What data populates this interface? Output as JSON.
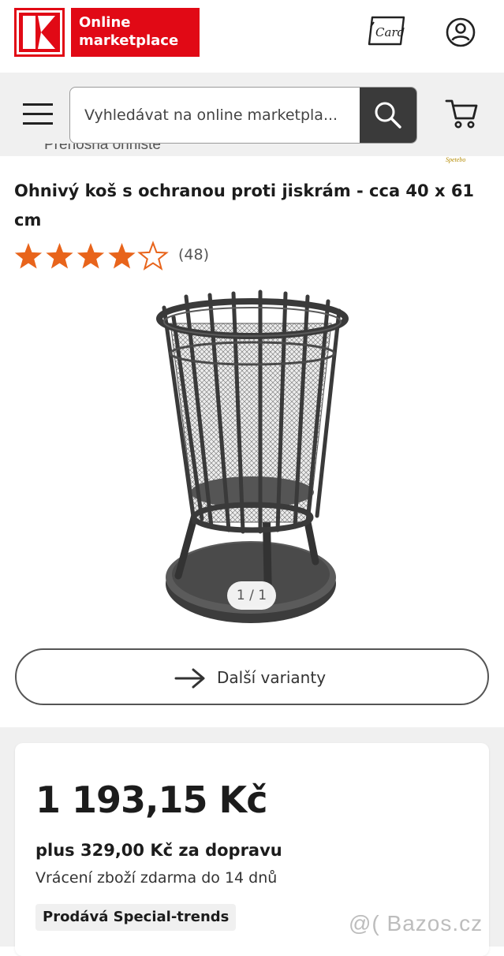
{
  "header": {
    "logo_text": "Online marketplace",
    "logo_brand_color": "#e10915",
    "card_icon": "kaufland-card-icon",
    "account_icon": "account-icon"
  },
  "search": {
    "menu_icon": "hamburger-menu-icon",
    "placeholder": "Vyhledávat na online marketpla...",
    "button_icon": "search-icon",
    "cart_icon": "cart-icon"
  },
  "breadcrumb": {
    "text": "Přenosná ohniště"
  },
  "brand_mark": "Spetebo",
  "product": {
    "title": "Ohnivý koš s ochranou proti jiskrám - cca 40 x 61 cm",
    "rating": 4,
    "rating_max": 5,
    "rating_count": "(48)",
    "star_color": "#e8641b",
    "image_pager": "1 / 1",
    "variants_label": "Další varianty"
  },
  "offer": {
    "price": "1 193,15 Kč",
    "shipping": "plus 329,00 Kč za dopravu",
    "returns": "Vrácení zboží zdarma do 14 dnů",
    "seller": "Prodává Special-trends"
  },
  "watermark": "@( Bazos.cz"
}
